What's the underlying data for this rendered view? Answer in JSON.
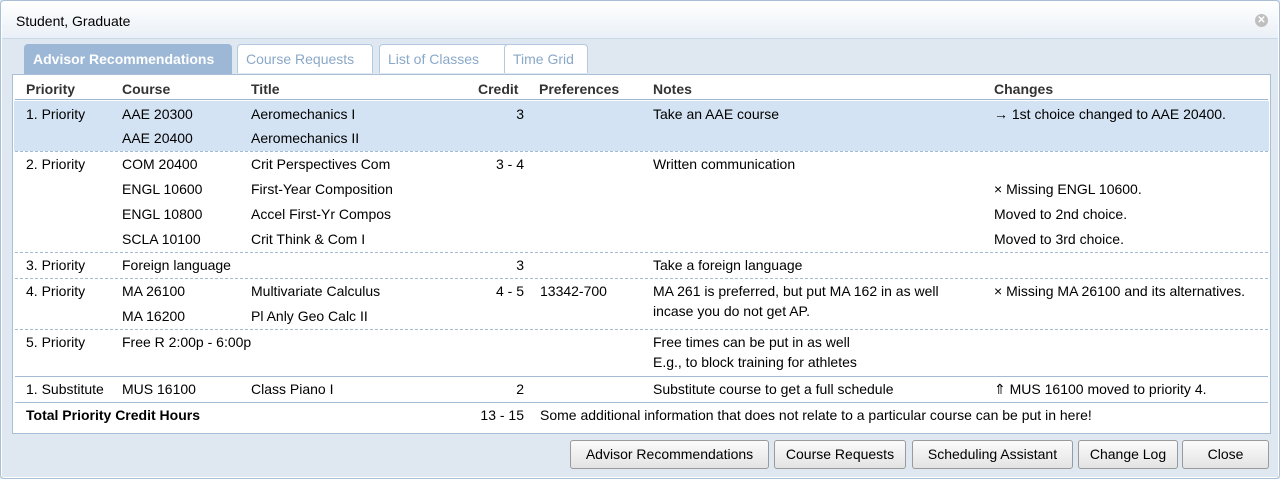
{
  "window": {
    "title": "Student, Graduate"
  },
  "tabs": [
    {
      "label": "Advisor Recommendations",
      "active": true
    },
    {
      "label": "Course Requests",
      "active": false
    },
    {
      "label": "List of Classes",
      "active": false
    },
    {
      "label": "Time Grid",
      "active": false
    }
  ],
  "table": {
    "headers": {
      "priority": "Priority",
      "course": "Course",
      "title": "Title",
      "credit": "Credit",
      "preferences": "Preferences",
      "notes": "Notes",
      "changes": "Changes"
    },
    "rows": [
      {
        "priority": "1. Priority",
        "course": "AAE 20300",
        "title": "Aeromechanics I",
        "credit": "3",
        "preferences": "",
        "notes": "Take an AAE course",
        "changes": "→ 1st choice changed to AAE 20400."
      },
      {
        "priority": "",
        "course": "AAE 20400",
        "title": "Aeromechanics II",
        "credit": "",
        "preferences": "",
        "notes": "",
        "changes": ""
      },
      {
        "priority": "2. Priority",
        "course": "COM 20400",
        "title": "Crit Perspectives Com",
        "credit": "3 - 4",
        "preferences": "",
        "notes": "Written communication",
        "changes": ""
      },
      {
        "priority": "",
        "course": "ENGL 10600",
        "title": "First-Year Composition",
        "credit": "",
        "preferences": "",
        "notes": "",
        "changes": "× Missing ENGL 10600."
      },
      {
        "priority": "",
        "course": "ENGL 10800",
        "title": "Accel First-Yr Compos",
        "credit": "",
        "preferences": "",
        "notes": "",
        "changes": "Moved to 2nd choice."
      },
      {
        "priority": "",
        "course": "SCLA 10100",
        "title": "Crit Think & Com I",
        "credit": "",
        "preferences": "",
        "notes": "",
        "changes": "Moved to 3rd choice."
      },
      {
        "priority": "3. Priority",
        "course": "Foreign language",
        "title": "",
        "credit": "3",
        "preferences": "",
        "notes": "Take a foreign language",
        "changes": ""
      },
      {
        "priority": "4. Priority",
        "course": "MA 26100",
        "title": "Multivariate Calculus",
        "credit": "4 - 5",
        "preferences": "13342-700",
        "notes": "MA 261 is preferred, but put MA 162 in as well",
        "changes": "× Missing MA 26100 and its alternatives."
      },
      {
        "priority": "",
        "course": "MA 16200",
        "title": "Pl Anly Geo Calc II",
        "credit": "",
        "preferences": "",
        "notes": "incase you do not get AP.",
        "changes": ""
      },
      {
        "priority": "5. Priority",
        "course": "Free R 2:00p - 6:00p",
        "title": "",
        "credit": "",
        "preferences": "",
        "notes": "Free times can be put in as well",
        "changes": ""
      },
      {
        "priority": "",
        "course": "",
        "title": "",
        "credit": "",
        "preferences": "",
        "notes": "E.g., to block training for athletes",
        "changes": ""
      },
      {
        "priority": "1. Substitute",
        "course": "MUS 16100",
        "title": "Class Piano I",
        "credit": "2",
        "preferences": "",
        "notes": "Substitute course to get a full schedule",
        "changes": "⇑ MUS 16100 moved to priority 4."
      }
    ],
    "total": {
      "label": "Total Priority Credit Hours",
      "credit": "13 - 15",
      "note": "Some additional information that does not relate to a particular course can be put in here!"
    }
  },
  "buttons": {
    "advisor_recommendations": "Advisor Recommendations",
    "course_requests": "Course Requests",
    "scheduling_assistant": "Scheduling Assistant",
    "change_log": "Change Log",
    "close": "Close"
  },
  "icons": {
    "close": "close-icon"
  },
  "colors": {
    "selected_row": "#d4e3f4",
    "active_tab": "#9db8d6",
    "inactive_tab_text": "#8aa8c8"
  }
}
